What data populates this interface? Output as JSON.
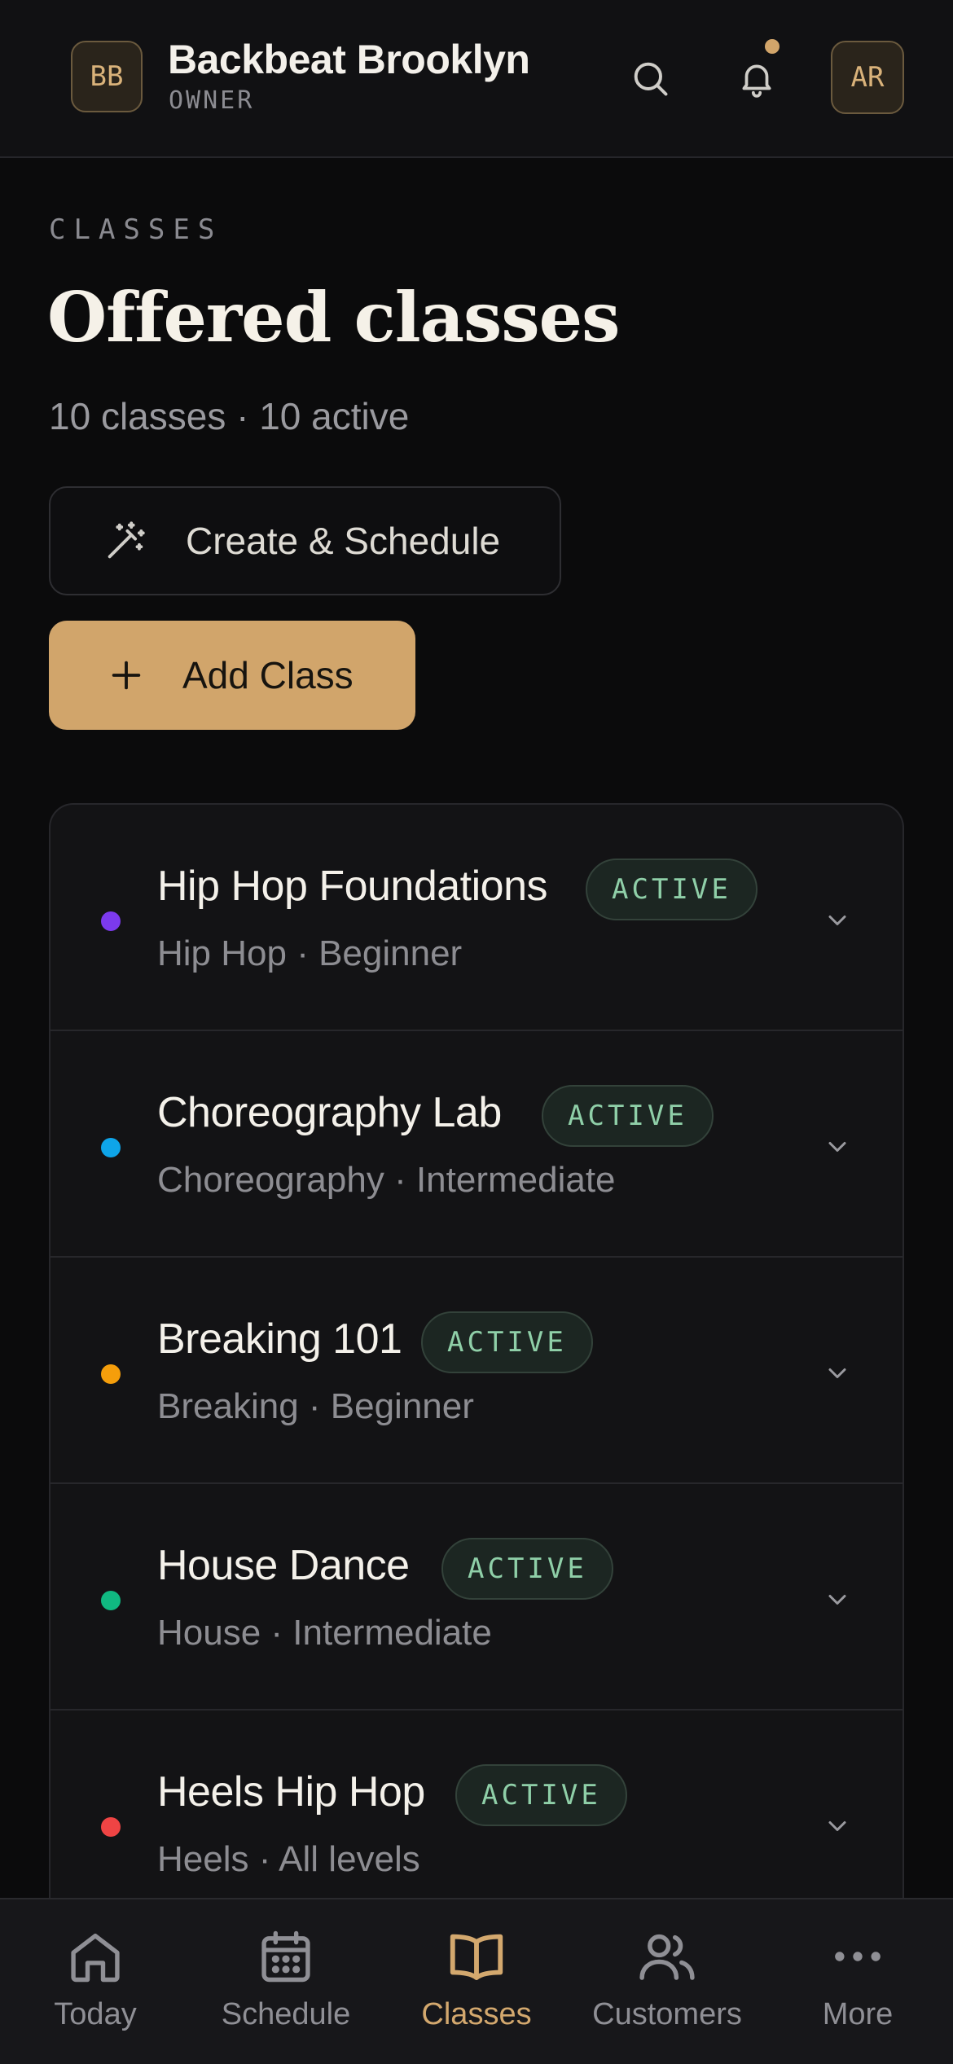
{
  "header": {
    "logo_initials": "BB",
    "studio_name": "Backbeat Brooklyn",
    "role": "OWNER",
    "user_initials": "AR",
    "has_unread_notifications": true
  },
  "page": {
    "eyebrow": "CLASSES",
    "title": "Offered classes",
    "summary": "10 classes · 10 active"
  },
  "actions": {
    "create_schedule_label": "Create & Schedule",
    "add_class_label": "Add Class"
  },
  "classes": [
    {
      "name": "Hip Hop Foundations",
      "status": "ACTIVE",
      "meta": "Hip Hop · Beginner",
      "color": "#7c3aed"
    },
    {
      "name": "Choreography Lab",
      "status": "ACTIVE",
      "meta": "Choreography · Intermediate",
      "color": "#0ea5e9"
    },
    {
      "name": "Breaking 101",
      "status": "ACTIVE",
      "meta": "Breaking · Beginner",
      "color": "#f59e0b"
    },
    {
      "name": "House Dance",
      "status": "ACTIVE",
      "meta": "House · Intermediate",
      "color": "#10b981"
    },
    {
      "name": "Heels Hip Hop",
      "status": "ACTIVE",
      "meta": "Heels · All levels",
      "color": "#ef4444"
    }
  ],
  "nav": {
    "items": [
      {
        "label": "Today",
        "icon": "home-icon"
      },
      {
        "label": "Schedule",
        "icon": "calendar-icon"
      },
      {
        "label": "Classes",
        "icon": "book-icon",
        "active": true
      },
      {
        "label": "Customers",
        "icon": "users-icon"
      },
      {
        "label": "More",
        "icon": "more-icon"
      }
    ]
  },
  "colors": {
    "accent": "#d1a56b",
    "background": "#0b0b0c",
    "active_status": "#8fcfa8"
  }
}
